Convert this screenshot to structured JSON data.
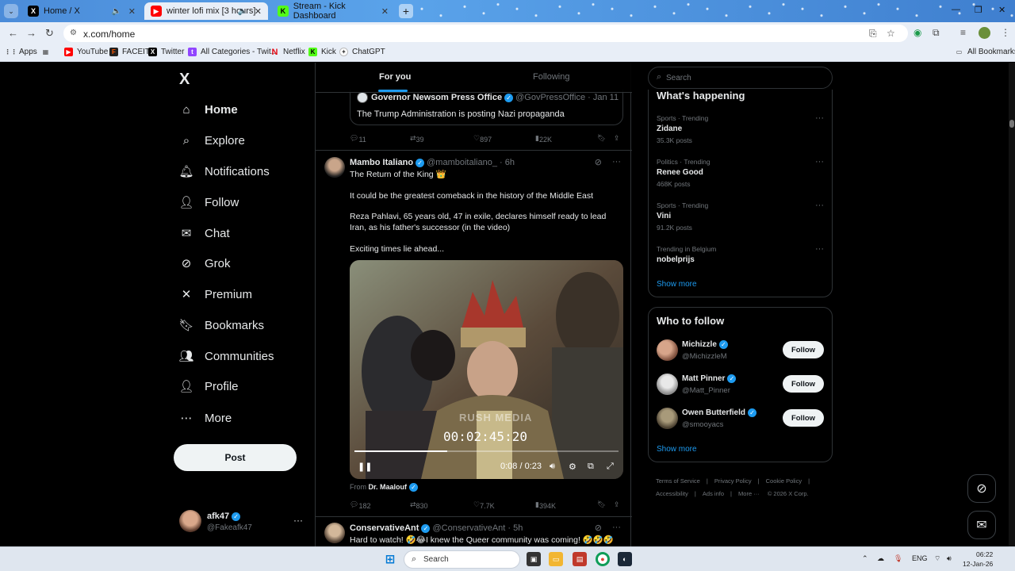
{
  "browser": {
    "tabs": [
      {
        "title": "Home / X",
        "active": false
      },
      {
        "title": "winter lofi mix [3 hours]",
        "active": true
      },
      {
        "title": "Stream - Kick Dashboard",
        "active": false
      }
    ],
    "url": "x.com/home",
    "bookmarks": [
      "Apps",
      "YouTube",
      "FACEIT",
      "Twitter",
      "All Categories - Twit...",
      "Netflix",
      "Kick",
      "ChatGPT"
    ],
    "all_bookmarks": "All Bookmarks"
  },
  "sidebar": {
    "logo": "X",
    "items": [
      {
        "label": "Home",
        "icon": "home-icon"
      },
      {
        "label": "Explore",
        "icon": "search-icon"
      },
      {
        "label": "Notifications",
        "icon": "bell-icon"
      },
      {
        "label": "Follow",
        "icon": "add-user-icon"
      },
      {
        "label": "Chat",
        "icon": "mail-icon"
      },
      {
        "label": "Grok",
        "icon": "grok-icon"
      },
      {
        "label": "Premium",
        "icon": "x-icon"
      },
      {
        "label": "Bookmarks",
        "icon": "bookmark-icon"
      },
      {
        "label": "Communities",
        "icon": "people-icon"
      },
      {
        "label": "Profile",
        "icon": "person-icon"
      },
      {
        "label": "More",
        "icon": "more-icon"
      }
    ],
    "post_label": "Post",
    "account": {
      "name": "afk47",
      "handle": "@Fakeafk47"
    }
  },
  "timeline": {
    "tabs": [
      "For you",
      "Following"
    ],
    "quote": {
      "author": "Governor Newsom Press Office",
      "handle": "@GovPressOffice · Jan 11",
      "text": "The Trump Administration is posting Nazi propaganda"
    },
    "quote_stats": {
      "replies": "11",
      "reposts": "39",
      "likes": "897",
      "views": "22K"
    },
    "tweet": {
      "author": "Mambo Italiano",
      "handle": "@mamboitaliano_ · 6h",
      "line1": "The Return of the King 👑",
      "line2": "It could be the greatest comeback in the history of the Middle East",
      "line3": "Reza Pahlavi, 65 years old, 47 in exile, declares himself ready to lead Iran, as his father's successor (in the video)",
      "line4": "Exciting times lie ahead...",
      "video_timestamp": "00:02:45:20",
      "video_watermark": "RUSH MEDIA",
      "video_time": "0:08 / 0:23",
      "video_progress": 0.35,
      "from_prefix": "From",
      "from_name": "Dr. Maalouf",
      "stats": {
        "replies": "182",
        "reposts": "830",
        "likes": "7.7K",
        "views": "394K"
      }
    },
    "next_tweet": {
      "author": "ConservativeAnt",
      "handle": "@ConservativeAnt · 5h",
      "text": "Hard to watch! 🤣😂I knew the Queer community was coming! 🤣🤣🤣"
    }
  },
  "right": {
    "search_placeholder": "Search",
    "happening_title": "What's happening",
    "trends": [
      {
        "category": "Sports · Trending",
        "name": "Zidane",
        "posts": "35.3K posts"
      },
      {
        "category": "Politics · Trending",
        "name": "Renee Good",
        "posts": "468K posts"
      },
      {
        "category": "Sports · Trending",
        "name": "Vini",
        "posts": "91.2K posts"
      },
      {
        "category": "Trending in Belgium",
        "name": "nobelprijs",
        "posts": ""
      }
    ],
    "show_more": "Show more",
    "wtf_title": "Who to follow",
    "wtf": [
      {
        "name": "Michizzle",
        "handle": "@MichizzleM"
      },
      {
        "name": "Matt Pinner",
        "handle": "@Matt_Pinner"
      },
      {
        "name": "Owen Butterfield",
        "handle": "@smooyacs"
      }
    ],
    "follow_label": "Follow",
    "footer": [
      "Terms of Service",
      "Privacy Policy",
      "Cookie Policy",
      "Accessibility",
      "Ads info",
      "More ···",
      "© 2026 X Corp."
    ]
  },
  "taskbar": {
    "search": "Search",
    "lang": "ENG",
    "time": "06:22",
    "date": "12-Jan-26"
  },
  "colors": {
    "accent": "#1d9bf0",
    "background": "#000000",
    "border": "#2f3336",
    "muted": "#71767b"
  }
}
